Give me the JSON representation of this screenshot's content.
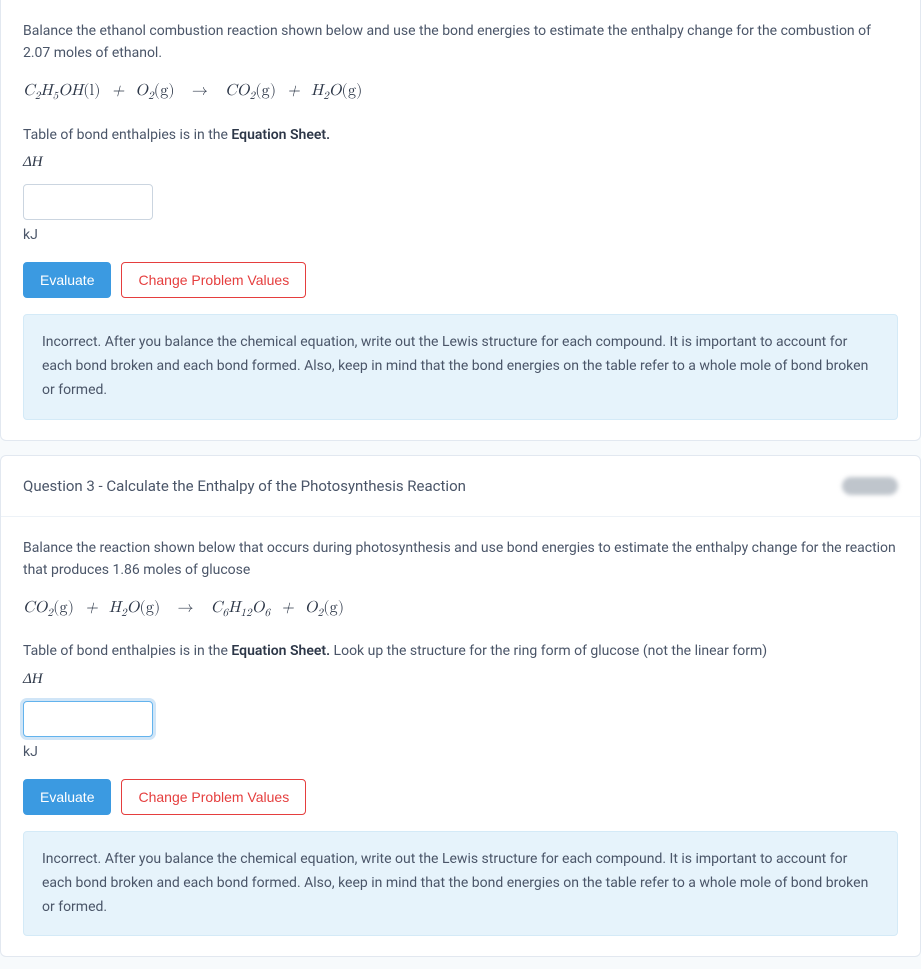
{
  "q2": {
    "prompt": "Balance the ethanol combustion reaction shown below and use the bond energies to estimate the enthalpy change for the combustion of 2.07 moles of ethanol.",
    "table_note_pre": "Table of bond enthalpies is in the ",
    "table_note_strong": "Equation Sheet.",
    "deltaH": "ΔH",
    "unit": "kJ",
    "evaluate": "Evaluate",
    "change": "Change Problem Values",
    "feedback": "Incorrect. After you balance the chemical equation, write out the Lewis structure for each compound. It is important to account for each bond broken and each bond formed. Also, keep in mind that the bond energies on the table refer to a whole mole of bond broken or formed."
  },
  "q3": {
    "header": "Question 3 - Calculate the Enthalpy of the Photosynthesis Reaction",
    "prompt": "Balance the reaction shown below that occurs during photosynthesis and use bond energies to estimate the enthalpy change for the reaction that produces  1.86 moles of glucose",
    "table_note_pre": "Table of bond enthalpies is in the ",
    "table_note_strong": "Equation Sheet.",
    "table_note_post": "  Look up the structure for the ring form of glucose (not the linear form)",
    "deltaH": "ΔH",
    "unit": "kJ",
    "evaluate": "Evaluate",
    "change": "Change Problem Values",
    "feedback": "Incorrect. After you balance the chemical equation, write out the Lewis structure for each compound. It is important to account for each bond broken and each bond formed. Also, keep in mind that the bond energies on the table refer to a whole mole of bond broken or formed."
  }
}
